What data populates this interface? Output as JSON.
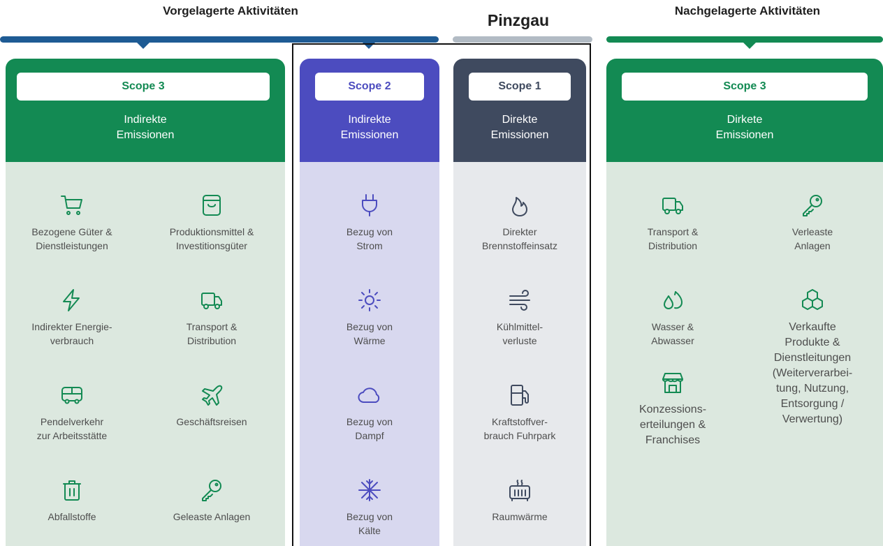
{
  "headers": {
    "upstream": "Vorgelagerte Aktivitäten",
    "center": "Pinzgau",
    "downstream": "Nachgelagerte Aktivitäten"
  },
  "colors": {
    "green": "#138a53",
    "green_light": "#dce8df",
    "blue_bar": "#1e5b94",
    "purple": "#4c4cbf",
    "purple_light": "#d8d8ef",
    "slate": "#3f4a5f",
    "slate_light": "#e7e9ec",
    "gray_bar": "#b2bbc4"
  },
  "columns": {
    "scope3_up": {
      "pill": "Scope 3",
      "subtitle": [
        "Indirekte",
        "Emissionen"
      ],
      "items": [
        {
          "icon": "shopping-cart-icon",
          "label": [
            "Bezogene Güter &",
            "Dienstleistungen"
          ]
        },
        {
          "icon": "shopping-bag-icon",
          "label": [
            "Produktionsmittel &",
            "Investitionsgüter"
          ]
        },
        {
          "icon": "lightning-icon",
          "label": [
            "Indirekter Energie-",
            "verbrauch"
          ]
        },
        {
          "icon": "truck-icon",
          "label": [
            "Transport &",
            "Distribution"
          ]
        },
        {
          "icon": "bus-icon",
          "label": [
            "Pendelverkehr",
            "zur Arbeitsstätte"
          ]
        },
        {
          "icon": "airplane-icon",
          "label": [
            "Geschäftsreisen"
          ]
        },
        {
          "icon": "trash-icon",
          "label": [
            "Abfallstoffe"
          ]
        },
        {
          "icon": "key-icon",
          "label": [
            "Geleaste Anlagen"
          ]
        }
      ]
    },
    "scope2": {
      "pill": "Scope 2",
      "subtitle": [
        "Indirekte",
        "Emissionen"
      ],
      "items": [
        {
          "icon": "plug-icon",
          "label": [
            "Bezug von",
            "Strom"
          ]
        },
        {
          "icon": "sun-icon",
          "label": [
            "Bezug von",
            "Wärme"
          ]
        },
        {
          "icon": "cloud-icon",
          "label": [
            "Bezug von",
            "Dampf"
          ]
        },
        {
          "icon": "snowflake-icon",
          "label": [
            "Bezug von",
            "Kälte"
          ]
        }
      ]
    },
    "scope1": {
      "pill": "Scope 1",
      "subtitle": [
        "Direkte",
        "Emissionen"
      ],
      "items": [
        {
          "icon": "flame-icon",
          "label": [
            "Direkter",
            "Brennstoffeinsatz"
          ]
        },
        {
          "icon": "wind-icon",
          "label": [
            "Kühlmittel-",
            "verluste"
          ]
        },
        {
          "icon": "fuel-pump-icon",
          "label": [
            "Kraftstoffver-",
            "brauch Fuhrpark"
          ]
        },
        {
          "icon": "heater-icon",
          "label": [
            "Raumwärme"
          ]
        }
      ]
    },
    "scope3_down": {
      "pill": "Scope 3",
      "subtitle": [
        "Dirkete",
        "Emissionen"
      ],
      "items": [
        {
          "icon": "truck-icon",
          "label": [
            "Transport &",
            "Distribution"
          ]
        },
        {
          "icon": "key-icon",
          "label": [
            "Verleaste",
            "Anlagen"
          ]
        },
        {
          "icon": "water-drops-icon",
          "label": [
            "Wasser &",
            "Abwasser"
          ]
        },
        {
          "icon": "boxes-icon",
          "label": [
            "Verkaufte",
            "Produkte &",
            "Dienstleitungen",
            "(Weiterverarbei-",
            "tung, Nutzung,",
            "Entsorgung /",
            "Verwertung)"
          ]
        },
        {
          "icon": "store-icon",
          "label": [
            "Konzessions-",
            "erteilungen &",
            "Franchises"
          ]
        }
      ]
    }
  }
}
